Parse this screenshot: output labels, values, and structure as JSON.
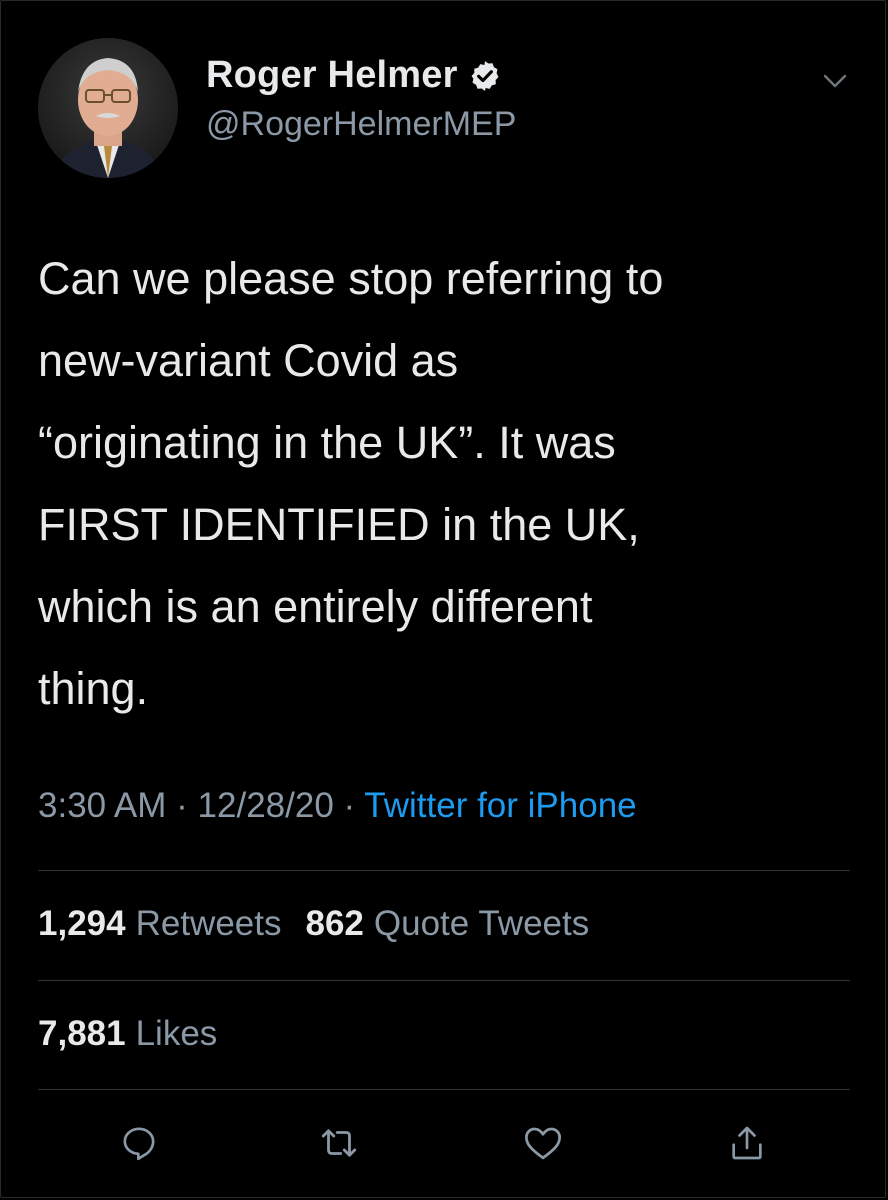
{
  "tweet": {
    "author": {
      "display_name": "Roger Helmer",
      "handle": "@RogerHelmerMEP",
      "verified": true,
      "avatar_icon": "profile-photo"
    },
    "text": "Can we please stop referring to\nnew-variant Covid as\n“originating in the UK”. It was\nFIRST IDENTIFIED in the UK,\nwhich is an entirely different\nthing.",
    "time": "3:30 AM",
    "separator": "·",
    "date": "12/28/20",
    "source": "Twitter for iPhone",
    "stats": {
      "retweets_count": "1,294",
      "retweets_label": "Retweets",
      "quotes_count": "862",
      "quotes_label": "Quote Tweets",
      "likes_count": "7,881",
      "likes_label": "Likes"
    },
    "actions": [
      {
        "icon": "reply-icon"
      },
      {
        "icon": "retweet-icon"
      },
      {
        "icon": "like-icon"
      },
      {
        "icon": "share-icon"
      }
    ]
  },
  "colors": {
    "background": "#000000",
    "text_primary": "#e7e9ea",
    "text_secondary": "#8b98a5",
    "accent": "#1d9bf0",
    "divider": "#2f3336"
  }
}
